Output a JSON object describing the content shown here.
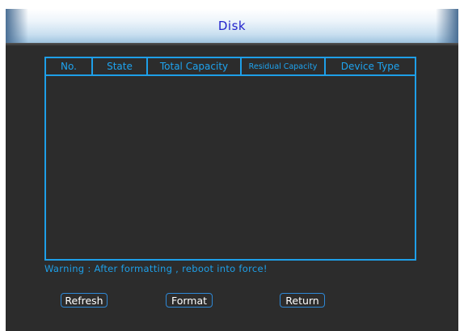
{
  "window": {
    "title": "Disk"
  },
  "table": {
    "columns": [
      "No.",
      "State",
      "Total Capacity",
      "Residual Capacity",
      "Device Type"
    ],
    "rows": []
  },
  "warning": "Warning : After formatting , reboot into force!",
  "buttons": {
    "refresh": "Refresh",
    "format": "Format",
    "return": "Return"
  },
  "colors": {
    "accent": "#1e9fe8",
    "title_text": "#2222cc",
    "background": "#2c2c2c"
  }
}
